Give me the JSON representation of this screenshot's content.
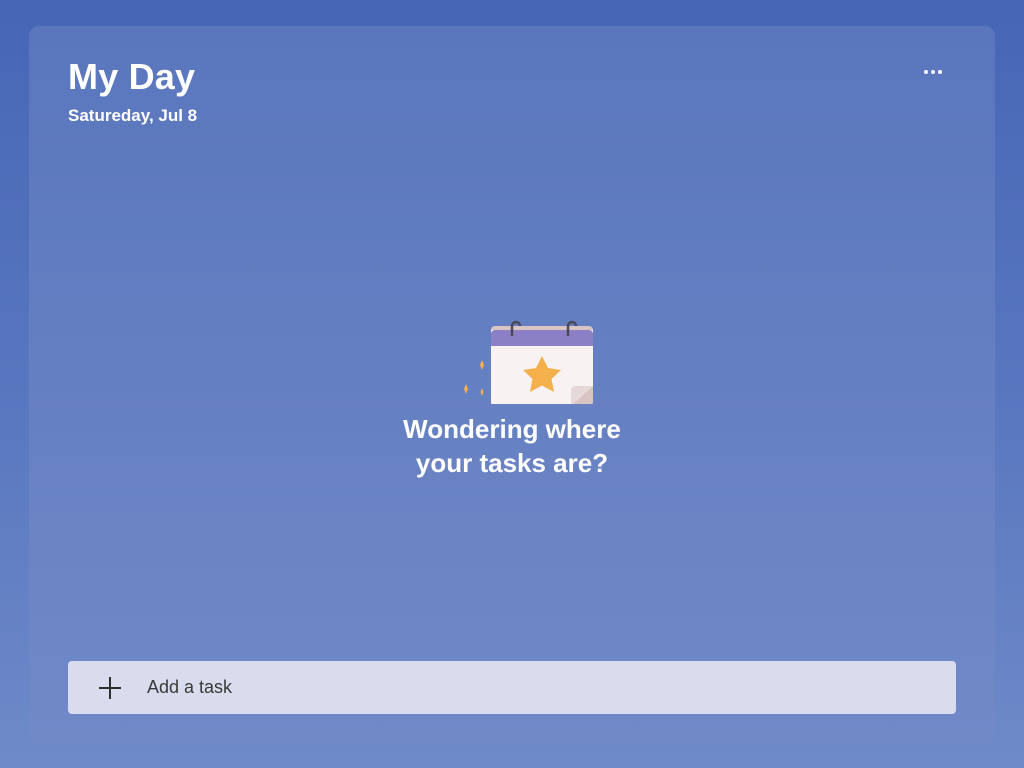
{
  "header": {
    "title": "My Day",
    "date": "Satureday, Jul 8",
    "more_icon": "more-horizontal-icon"
  },
  "empty_state": {
    "illustration": "calendar-star-icon",
    "line1": "Wondering where",
    "line2": "your tasks are?"
  },
  "add_task": {
    "icon": "plus-icon",
    "label": "Add a task"
  },
  "colors": {
    "background": "#4666b6",
    "panel": "#6580c2",
    "add_task_bar": "#d8dcec",
    "calendar_header": "#8b7fc6",
    "star": "#f4b04b"
  }
}
